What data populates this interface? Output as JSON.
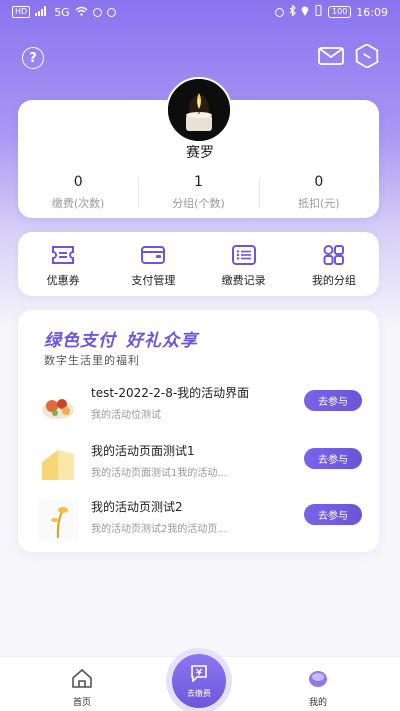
{
  "status_bar": {
    "left_chips": [
      "HD",
      "5G"
    ],
    "time": "16:09",
    "battery": "100"
  },
  "profile": {
    "username": "赛罗",
    "stats": [
      {
        "value": "0",
        "label": "缴费(次数)"
      },
      {
        "value": "1",
        "label": "分组(个数)"
      },
      {
        "value": "0",
        "label": "抵扣(元)"
      }
    ]
  },
  "quick_menu": [
    {
      "label": "优惠券",
      "icon": "coupon-icon"
    },
    {
      "label": "支付管理",
      "icon": "wallet-icon"
    },
    {
      "label": "缴费记录",
      "icon": "list-icon"
    },
    {
      "label": "我的分组",
      "icon": "grid-icon"
    }
  ],
  "promo": {
    "title_part1": "绿色支付",
    "title_part2": "好礼众享",
    "subtitle": "数字生活里的福利",
    "activities": [
      {
        "title": "test-2022-2-8-我的活动界面",
        "desc": "我的活动位测试",
        "button": "去参与"
      },
      {
        "title": "我的活动页面测试1",
        "desc": "我的活动页面测试1我的活动...",
        "button": "去参与"
      },
      {
        "title": "我的活动页测试2",
        "desc": "我的活动页测试2我的活动页...",
        "button": "去参与"
      }
    ]
  },
  "tabbar": {
    "home": "首页",
    "pay": "去缴费",
    "mine": "我的"
  },
  "colors": {
    "accent": "#6b56e0",
    "header_gradient_top": "#8b73ef"
  }
}
